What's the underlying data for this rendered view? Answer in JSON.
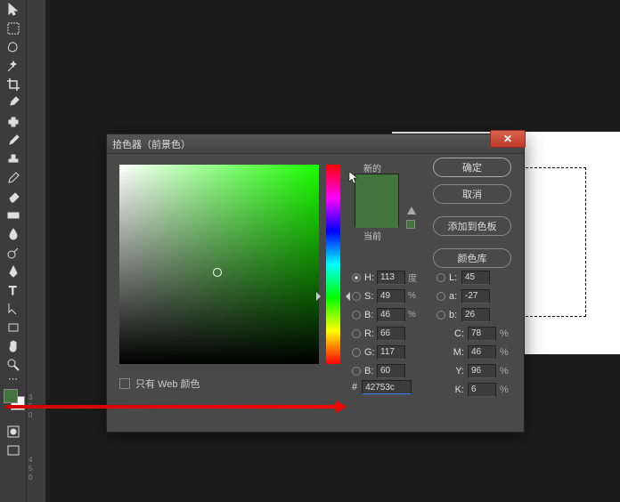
{
  "dialog": {
    "title": "拾色器（前景色）",
    "new_label": "新的",
    "current_label": "当前",
    "ok": "确定",
    "cancel": "取消",
    "add_swatch": "添加到色板",
    "color_lib": "颜色库",
    "web_only": "只有 Web 颜色",
    "hex_label": "#",
    "hex_value": "42753c"
  },
  "hsb": {
    "h_label": "H:",
    "h": "113",
    "h_unit": "度",
    "s_label": "S:",
    "s": "49",
    "s_unit": "%",
    "b_label": "B:",
    "b": "46",
    "b_unit": "%"
  },
  "rgb": {
    "r_label": "R:",
    "r": "66",
    "g_label": "G:",
    "g": "117",
    "b_label": "B:",
    "b": "60"
  },
  "lab": {
    "l_label": "L:",
    "l": "45",
    "a_label": "a:",
    "a": "-27",
    "b_label": "b:",
    "b": "26"
  },
  "cmyk": {
    "c_label": "C:",
    "c": "78",
    "u": "%",
    "m_label": "M:",
    "m": "46",
    "y_label": "Y:",
    "y": "96",
    "k_label": "K:",
    "k": "6"
  },
  "ruler": {
    "t1": "3",
    "t2": "5",
    "t3": "0",
    "t4": "4",
    "t5": "5",
    "t6": "0"
  }
}
